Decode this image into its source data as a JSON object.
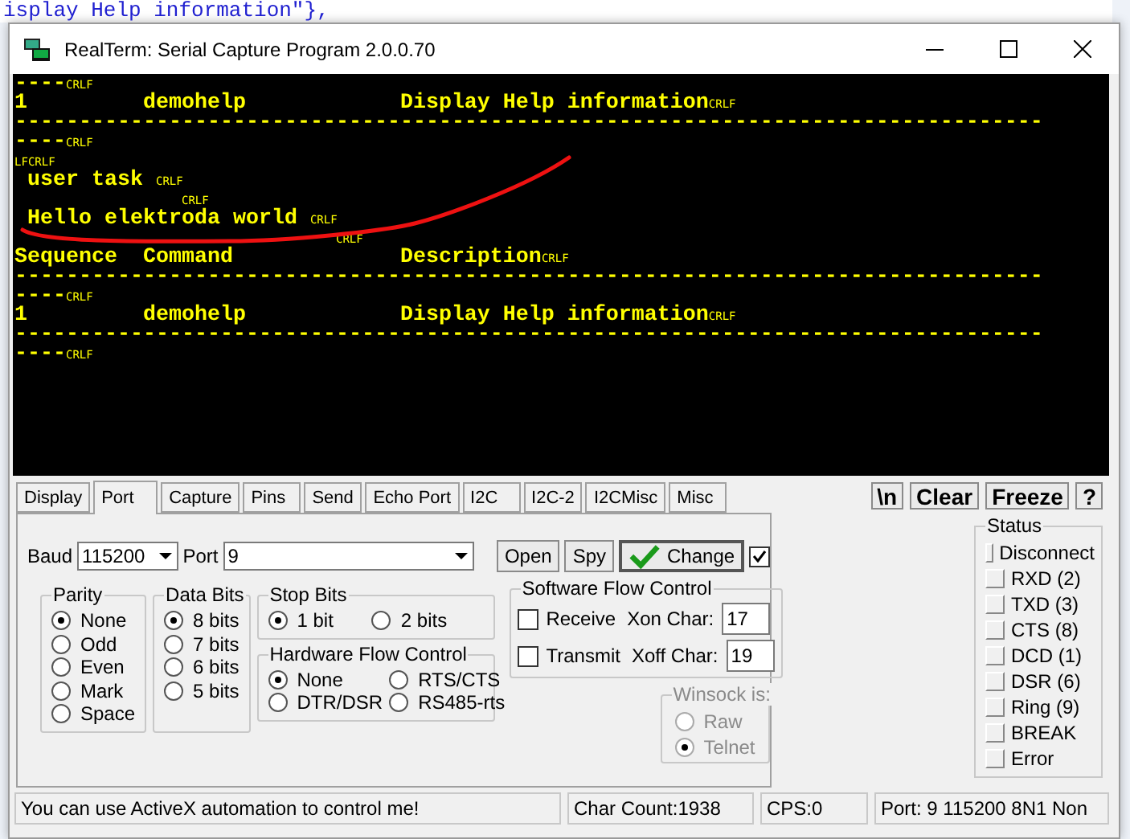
{
  "background_editor": {
    "text": "isplay Help information\"},"
  },
  "window": {
    "title": "RealTerm: Serial Capture Program 2.0.0.70"
  },
  "terminal": {
    "lines": [
      {
        "text": "----",
        "marks": [
          "CRLF"
        ]
      },
      {
        "text": "1         demohelp            Display Help information",
        "marks": [
          "CRLF"
        ]
      },
      {
        "text": "--------------------------------------------------------------------------------"
      },
      {
        "text": "----",
        "marks": [
          "CRLF"
        ]
      },
      {
        "marks": [
          "LF",
          "CRLF"
        ]
      },
      {
        "text": " user task ",
        "marks": [
          "CRLF"
        ]
      },
      {
        "kind": "wrap",
        "marks": [
          "CRLF"
        ]
      },
      {
        "text": " Hello elektroda world ",
        "marks": [
          "CRLF"
        ]
      },
      {
        "kind": "wrap",
        "marks": [
          "CRLF"
        ]
      },
      {
        "text": "Sequence  Command             Description",
        "marks": [
          "CRLF"
        ]
      },
      {
        "text": "--------------------------------------------------------------------------------"
      },
      {
        "text": "----",
        "marks": [
          "CRLF"
        ]
      },
      {
        "text": "1         demohelp            Display Help information",
        "marks": [
          "CRLF"
        ]
      },
      {
        "text": "--------------------------------------------------------------------------------"
      },
      {
        "text": "----",
        "marks": [
          "CRLF"
        ]
      }
    ]
  },
  "tabs": [
    {
      "label": "Display",
      "selected": false
    },
    {
      "label": "Port",
      "selected": true
    },
    {
      "label": "Capture",
      "selected": false
    },
    {
      "label": "Pins",
      "selected": false
    },
    {
      "label": "Send",
      "selected": false
    },
    {
      "label": "Echo Port",
      "selected": false
    },
    {
      "label": "I2C",
      "selected": false
    },
    {
      "label": "I2C-2",
      "selected": false
    },
    {
      "label": "I2CMisc",
      "selected": false
    },
    {
      "label": "Misc",
      "selected": false
    }
  ],
  "toolbar_buttons": [
    {
      "label": "\\n"
    },
    {
      "label": "Clear"
    },
    {
      "label": "Freeze"
    },
    {
      "label": "?"
    }
  ],
  "port": {
    "baud_label": "Baud",
    "baud": "115200",
    "port_label": "Port",
    "port": "9",
    "buttons": [
      "Open",
      "Spy"
    ],
    "change": {
      "label": "Change",
      "checked": true
    },
    "parity": {
      "title": "Parity",
      "options": [
        {
          "label": "None",
          "selected": true
        },
        {
          "label": "Odd",
          "selected": false
        },
        {
          "label": "Even",
          "selected": false
        },
        {
          "label": "Mark",
          "selected": false
        },
        {
          "label": "Space",
          "selected": false
        }
      ]
    },
    "data_bits": {
      "title": "Data Bits",
      "options": [
        {
          "label": "8 bits",
          "selected": true
        },
        {
          "label": "7 bits",
          "selected": false
        },
        {
          "label": "6 bits",
          "selected": false
        },
        {
          "label": "5 bits",
          "selected": false
        }
      ]
    },
    "stop_bits": {
      "title": "Stop Bits",
      "options": [
        {
          "label": "1 bit",
          "selected": true
        },
        {
          "label": "2 bits",
          "selected": false
        }
      ]
    },
    "hardware_flow": {
      "title": "Hardware Flow Control",
      "options": [
        {
          "label": "None",
          "selected": true
        },
        {
          "label": "RTS/CTS",
          "selected": false
        },
        {
          "label": "DTR/DSR",
          "selected": false
        },
        {
          "label": "RS485-rts",
          "selected": false
        }
      ]
    },
    "software_flow": {
      "title": "Software Flow Control",
      "rows": [
        {
          "label": "Receive",
          "checked": false,
          "char_label": "Xon Char:",
          "value": "17"
        },
        {
          "label": "Transmit",
          "checked": false,
          "char_label": "Xoff Char:",
          "value": "19"
        }
      ]
    },
    "winsock": {
      "title": "Winsock is:",
      "disabled": true,
      "options": [
        {
          "label": "Raw",
          "selected": false
        },
        {
          "label": "Telnet",
          "selected": true
        }
      ]
    }
  },
  "status": {
    "title": "Status",
    "items": [
      "Disconnect",
      "RXD (2)",
      "TXD (3)",
      "CTS (8)",
      "DCD (1)",
      "DSR (6)",
      "Ring (9)",
      "BREAK",
      "Error"
    ]
  },
  "status_bar": [
    "You can use ActiveX automation to control me!",
    "Char Count:1938",
    "CPS:0",
    "Port: 9 115200 8N1 Non"
  ]
}
